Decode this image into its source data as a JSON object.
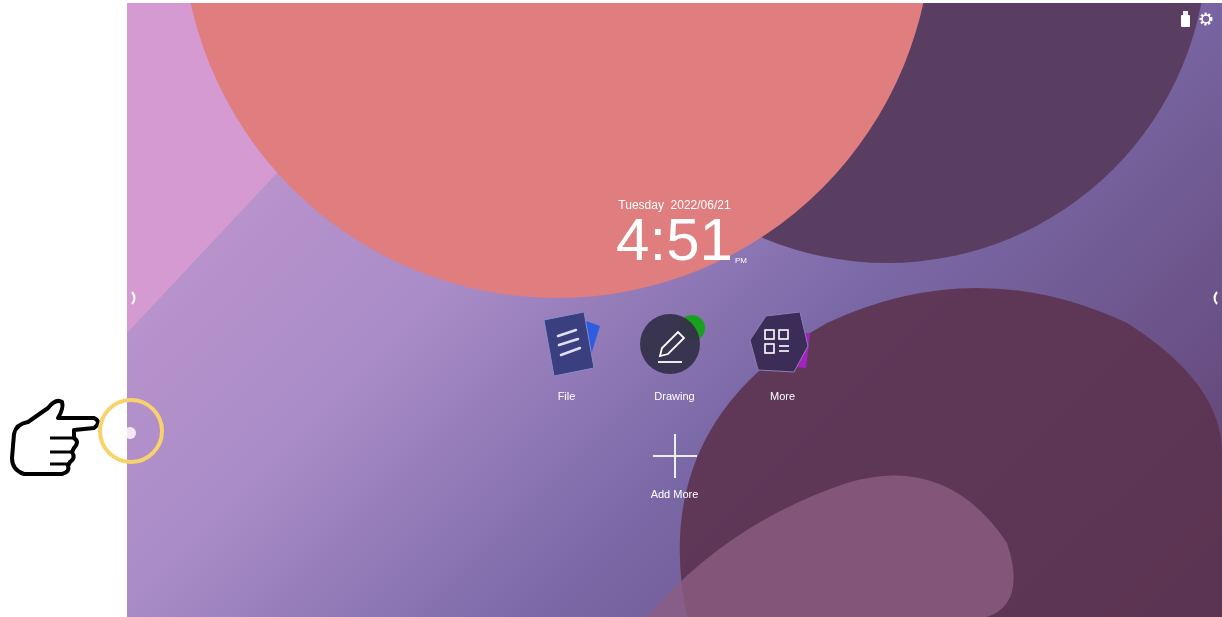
{
  "clock": {
    "date": "Tuesday  2022/06/21",
    "time": "4:51",
    "meridiem": "PM"
  },
  "apps": [
    {
      "kind": "file",
      "label": "File"
    },
    {
      "kind": "drawing",
      "label": "Drawing"
    },
    {
      "kind": "more",
      "label": "More"
    }
  ],
  "add_more": {
    "label": "Add More"
  }
}
